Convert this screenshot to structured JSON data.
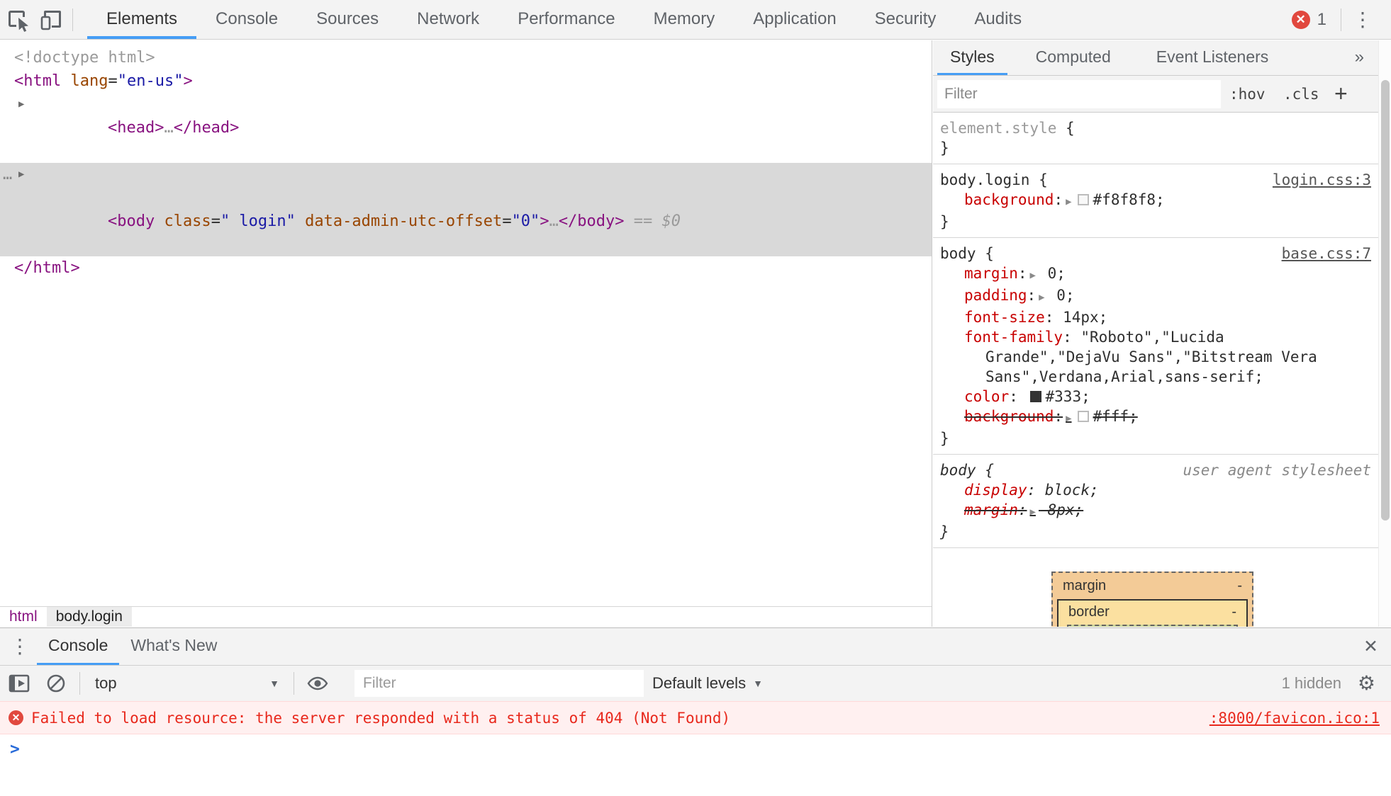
{
  "colors": {
    "accent_blue": "#459df5",
    "badge_red": "#e1483e",
    "error_text_red": "#e8281c",
    "error_bg": "#fff0f0",
    "tag_purple": "#881280",
    "attr_orange": "#994500",
    "value_blue": "#1a1aa6",
    "property_red": "#c80000",
    "selected_row_gray": "#d9d9d9",
    "boxmodel_margin_tan": "#f3cb97",
    "boxmodel_border_yellow": "#fbe0a0"
  },
  "toolbar": {
    "tabs": [
      "Elements",
      "Console",
      "Sources",
      "Network",
      "Performance",
      "Memory",
      "Application",
      "Security",
      "Audits"
    ],
    "selected_tab": "Elements",
    "error_count": "1",
    "kebab_icon": "⋮"
  },
  "dom_tree": {
    "triangle": "▶",
    "gutter_dots": "…",
    "line1": [
      {
        "c": "gray",
        "t": "<!doctype html>"
      }
    ],
    "line2": [
      {
        "c": "tag",
        "t": "<html"
      },
      {
        "c": "attr",
        "t": " lang"
      },
      {
        "c": "plain",
        "t": "="
      },
      {
        "c": "val",
        "t": "\"en-us\""
      },
      {
        "c": "tag",
        "t": ">"
      }
    ],
    "line3": [
      {
        "c": "tag",
        "t": "<head>"
      },
      {
        "c": "gray",
        "t": "…"
      },
      {
        "c": "tag",
        "t": "</head>"
      }
    ],
    "line4": [
      {
        "c": "tag",
        "t": "<body"
      },
      {
        "c": "attr",
        "t": " class"
      },
      {
        "c": "plain",
        "t": "="
      },
      {
        "c": "val",
        "t": "\" login\""
      },
      {
        "c": "attr",
        "t": " data-admin-utc-offset"
      },
      {
        "c": "plain",
        "t": "="
      },
      {
        "c": "val",
        "t": "\"0\""
      },
      {
        "c": "tag",
        "t": ">"
      },
      {
        "c": "gray",
        "t": "…"
      },
      {
        "c": "tag",
        "t": "</body>"
      },
      {
        "c": "gray",
        "t": " == "
      },
      {
        "c": "gray-i",
        "t": "$0"
      }
    ],
    "line5": [
      {
        "c": "tag",
        "t": "</html>"
      }
    ]
  },
  "breadcrumb": {
    "crumb1": "html",
    "crumb2": "body.login"
  },
  "styles_pane": {
    "tabs": [
      "Styles",
      "Computed",
      "Event Listeners"
    ],
    "selected_tab": "Styles",
    "more_tabs_icon": "»",
    "filter_placeholder": "Filter",
    "hov_label": ":hov",
    "cls_label": ".cls",
    "plus_label": "+",
    "close_brace": "}",
    "rule_element_style": {
      "selector": [
        {
          "c": "gray",
          "t": "element.style"
        },
        {
          "c": "plain",
          "t": " {"
        }
      ]
    },
    "rule_body_login": {
      "selector": [
        {
          "c": "plain",
          "t": "body.login {"
        }
      ],
      "link": "login.css:3",
      "decl_background": [
        {
          "c": "prop",
          "t": "background"
        },
        {
          "c": "plain",
          "t": ":"
        },
        {
          "c": "arrow",
          "t": "▶"
        },
        {
          "bg": "#f8f8f8"
        },
        {
          "c": "plain",
          "t": "#f8f8f8;"
        }
      ]
    },
    "rule_body": {
      "selector": [
        {
          "c": "plain",
          "t": "body {"
        }
      ],
      "link": "base.css:7",
      "decl_margin": [
        {
          "c": "prop",
          "t": "margin"
        },
        {
          "c": "plain",
          "t": ":"
        },
        {
          "c": "arrow",
          "t": "▶"
        },
        {
          "c": "plain",
          "t": " 0;"
        }
      ],
      "decl_padding": [
        {
          "c": "prop",
          "t": "padding"
        },
        {
          "c": "plain",
          "t": ":"
        },
        {
          "c": "arrow",
          "t": "▶"
        },
        {
          "c": "plain",
          "t": " 0;"
        }
      ],
      "decl_font_size": [
        {
          "c": "prop",
          "t": "font-size"
        },
        {
          "c": "plain",
          "t": ": 14px;"
        }
      ],
      "decl_font_family_1": [
        {
          "c": "prop",
          "t": "font-family"
        },
        {
          "c": "plain",
          "t": ": \"Roboto\",\"Lucida"
        }
      ],
      "decl_font_family_2": [
        {
          "c": "plain",
          "t": "Grande\",\"DejaVu Sans\",\"Bitstream Vera"
        }
      ],
      "decl_font_family_3": [
        {
          "c": "plain",
          "t": "Sans\",Verdana,Arial,sans-serif;"
        }
      ],
      "decl_color": [
        {
          "c": "prop",
          "t": "color"
        },
        {
          "c": "plain",
          "t": ": "
        },
        {
          "bg": "#333",
          "b": "#333"
        },
        {
          "c": "plain",
          "t": "#333;"
        }
      ],
      "decl_background": [
        {
          "c": "prop",
          "t": "background"
        },
        {
          "c": "plain",
          "t": ":"
        },
        {
          "c": "arrow",
          "t": "▶"
        },
        {
          "bg": "#fff"
        },
        {
          "c": "plain",
          "t": "#fff;"
        }
      ]
    },
    "rule_user_agent": {
      "selector": [
        {
          "c": "plain",
          "t": "body {"
        }
      ],
      "link": "user agent stylesheet",
      "decl_display": [
        {
          "c": "prop",
          "t": "display"
        },
        {
          "c": "plain",
          "t": ": block;"
        }
      ],
      "decl_margin": [
        {
          "c": "prop",
          "t": "margin"
        },
        {
          "c": "plain",
          "t": ":"
        },
        {
          "c": "arrow",
          "t": "▶"
        },
        {
          "c": "plain",
          "t": " 8px;"
        }
      ]
    },
    "box_model": {
      "margin_label": "margin",
      "border_label": "border",
      "margin_value": "-",
      "border_value": "-"
    }
  },
  "console": {
    "kebab_icon": "⋮",
    "tabs": [
      "Console",
      "What's New"
    ],
    "selected_tab": "Console",
    "close_icon": "✕",
    "toolbar": {
      "context_selector": "top",
      "caret": "▼",
      "filter_placeholder": "Filter",
      "levels_label": "Default levels",
      "levels_caret": "▼",
      "hidden_count": "1 hidden",
      "gear_icon": "⚙"
    },
    "error": {
      "icon": "✕",
      "message": "Failed to load resource: the server responded with a status of 404 (Not Found)",
      "source_link": ":8000/favicon.ico:1"
    },
    "prompt": ">"
  }
}
